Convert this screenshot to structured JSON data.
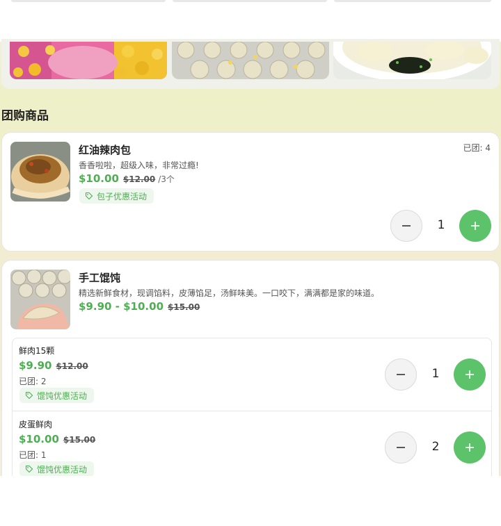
{
  "section": {
    "title": "团购商品"
  },
  "products": [
    {
      "name": "红油辣肉包",
      "description": "香香啦啦，超级入味，非常过瘾!",
      "price": "$10.00",
      "original_price": "$12.00",
      "unit": "/3个",
      "joined": "已团: 4",
      "tag": "包子优惠活动",
      "quantity": "1"
    },
    {
      "name": "手工馄饨",
      "description": "精选新鲜食材，现调馅料，皮薄馅足，汤鲜味美。一口咬下，满满都是家的味道。",
      "price_range": "$9.90 - $10.00",
      "original_price": "$15.00",
      "variants": [
        {
          "name": "鲜肉15颗",
          "price": "$9.90",
          "original_price": "$12.00",
          "joined": "已团: 2",
          "tag": "馄饨优惠活动",
          "quantity": "1"
        },
        {
          "name": "皮蛋鲜肉",
          "price": "$10.00",
          "original_price": "$15.00",
          "joined": "已团: 1",
          "tag": "馄饨优惠活动",
          "quantity": "2"
        }
      ]
    }
  ],
  "colors": {
    "accent": "#5cc36b",
    "price": "#4caf50",
    "tag_bg": "#eef7ee"
  },
  "icons": {
    "tag": "tag-icon",
    "minus": "minus-icon",
    "plus": "plus-icon"
  }
}
